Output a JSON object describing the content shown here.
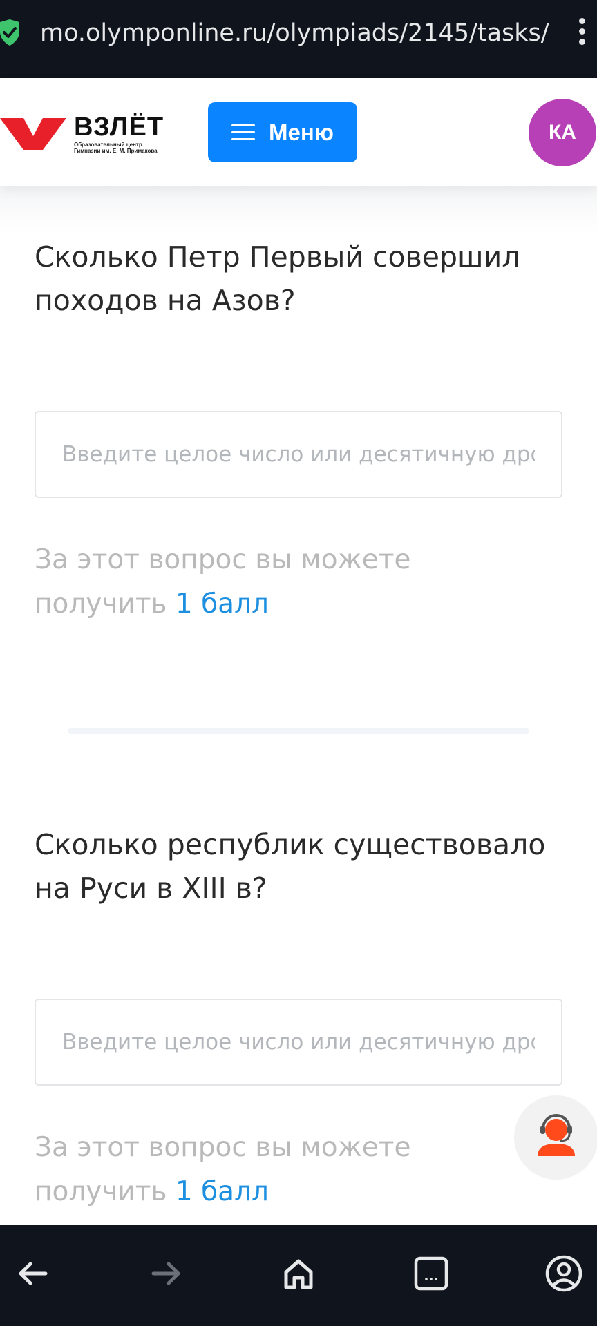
{
  "browser": {
    "url": "mo.olymponline.ru/olympiads/2145/tasks/"
  },
  "header": {
    "logo_title": "ВЗЛЁТ",
    "logo_subtitle_line1": "Образовательный центр",
    "logo_subtitle_line2": "Гимназии им. Е. М. Примакова",
    "menu_label": "Меню",
    "avatar_initials": "КА",
    "menu_color": "#0a84ff",
    "avatar_color": "#b840b6",
    "logo_color": "#e8202a"
  },
  "questions": [
    {
      "text": "Сколько Петр Первый совершил походов на Азов?",
      "input_placeholder": "Введите целое число или десятичную дробь",
      "input_value": "",
      "points_prefix": "За этот вопрос вы можете получить",
      "points_value": "1 балл"
    },
    {
      "text": "Сколько республик существовало на Руси в XIII в?",
      "input_placeholder": "Введите целое число или десятичную дробь",
      "input_value": "",
      "points_prefix": "За этот вопрос вы можете получить",
      "points_value": "1 балл"
    }
  ],
  "icons": {
    "secure": "shield-check-icon",
    "overflow": "kebab-menu-icon",
    "support": "support-agent-icon",
    "back": "arrow-left-icon",
    "forward": "arrow-right-icon",
    "home": "home-icon",
    "tabs": "tabs-icon",
    "account": "account-icon"
  }
}
